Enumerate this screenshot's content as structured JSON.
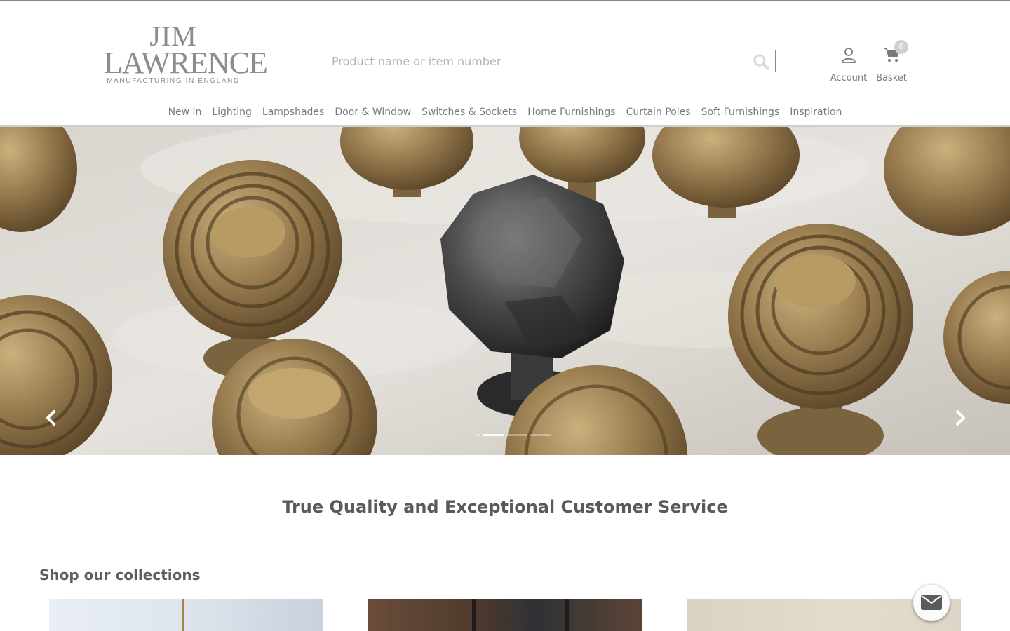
{
  "brand": {
    "line1": "JIM",
    "line2": "LAWRENCE",
    "tagline": "MANUFACTURING IN ENGLAND"
  },
  "search": {
    "placeholder": "Product name or item number",
    "value": ""
  },
  "header_actions": {
    "account_label": "Account",
    "basket_label": "Basket",
    "basket_count": "0"
  },
  "nav": {
    "items": [
      {
        "label": "New in"
      },
      {
        "label": "Lighting"
      },
      {
        "label": "Lampshades"
      },
      {
        "label": "Door & Window"
      },
      {
        "label": "Switches & Sockets"
      },
      {
        "label": "Home Furnishings"
      },
      {
        "label": "Curtain Poles"
      },
      {
        "label": "Soft Furnishings"
      },
      {
        "label": "Inspiration"
      }
    ]
  },
  "hero": {
    "slide_count": 4,
    "active_slide": 1,
    "prev_icon": "chevron-left-icon",
    "next_icon": "chevron-right-icon"
  },
  "main": {
    "tagline": "True Quality and Exceptional Customer Service",
    "collections_title": "Shop our collections"
  },
  "colors": {
    "text": "#555555",
    "nav_text": "#7b7b7b",
    "rule": "#cfcfcf",
    "badge": "#d0d0d0"
  },
  "icons": {
    "search": "search-icon",
    "account": "user-icon",
    "basket": "shopping-cart-icon",
    "chat": "envelope-icon"
  }
}
